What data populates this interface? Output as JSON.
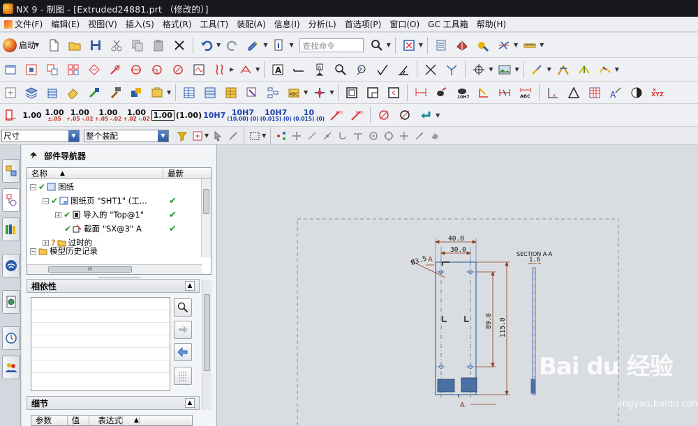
{
  "window": {
    "title": "NX 9 - 制图 - [Extruded24881.prt （修改的）]"
  },
  "menu": [
    "文件(F)",
    "编辑(E)",
    "视图(V)",
    "插入(S)",
    "格式(R)",
    "工具(T)",
    "装配(A)",
    "信息(I)",
    "分析(L)",
    "首选项(P)",
    "窗口(O)",
    "GC 工具箱",
    "帮助(H)"
  ],
  "toolbar": {
    "start_label": "启动",
    "search_placeholder": "查找命令",
    "tolerance_buttons": [
      {
        "main": "1.00",
        "sub": ""
      },
      {
        "main": "1.00",
        "sub": "±.05"
      },
      {
        "main": "1.00",
        "sub": "+.05 -.02"
      },
      {
        "main": "1.00",
        "sub": "+.05 -.02"
      },
      {
        "main": "1.00",
        "sub": "+.02 -.02"
      },
      {
        "main": "1.00",
        "sub": ""
      },
      {
        "main": "(1.00)",
        "sub": ""
      },
      {
        "main": "10H7",
        "sub": ""
      },
      {
        "main": "10H7",
        "sub": "(10.00) (0)"
      },
      {
        "main": "10H7",
        "sub": "(0.015) (0)"
      },
      {
        "main": "10",
        "sub": "(0.015) (0)"
      }
    ],
    "annotation_labels": {
      "h7": "10H7",
      "abc": "ABC",
      "xyz": "XYZ",
      "a": "A"
    }
  },
  "selection_bar": {
    "filter_value": "尺寸",
    "scope_value": "整个装配"
  },
  "navigator": {
    "title": "部件导航器",
    "columns": {
      "name": "名称",
      "newest": "最新"
    },
    "rows": [
      {
        "label": "图纸",
        "status": "✔",
        "newest": ""
      },
      {
        "label": "图纸页 \"SHT1\" (工...",
        "status": "✔",
        "newest": "✔"
      },
      {
        "label": "导入的 \"Top@1\"",
        "status": "✔",
        "newest": "✔"
      },
      {
        "label": "截面 \"SX@3\" A",
        "status": "✔",
        "newest": "✔"
      },
      {
        "label": "过时的",
        "status": "?",
        "newest": ""
      },
      {
        "label": "模型历史记录",
        "status": "",
        "newest": ""
      }
    ],
    "hscroll_label": "III"
  },
  "dependencies": {
    "title": "相依性"
  },
  "details": {
    "title": "细节",
    "columns": [
      "参数",
      "值",
      "表达式"
    ]
  },
  "drawing": {
    "dims": {
      "width_outer": "40.0",
      "width_inner": "30.0",
      "hole": "Ø3.5",
      "height_inner": "89.0",
      "height_outer": "115.0",
      "section_title": "SECTION A-A",
      "thickness": "1.6",
      "cut_label_top": "A",
      "cut_label_bottom": "A"
    }
  },
  "watermark": {
    "logo": "Bai du 经验",
    "url": "jingyan.baidu.com"
  },
  "colors": {
    "titlebar": "#16181c",
    "drawing_blue": "#4a6fa5",
    "dim_brown": "#8a3b1a",
    "check_green": "#1e9a2a"
  }
}
